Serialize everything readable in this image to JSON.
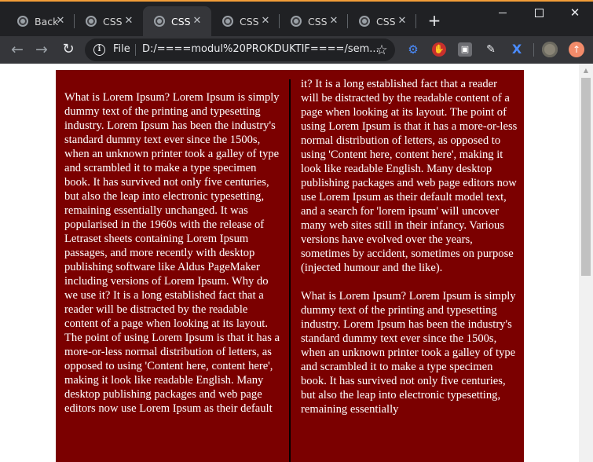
{
  "tabs": [
    {
      "label": "Back",
      "active": false
    },
    {
      "label": "CSS",
      "active": false
    },
    {
      "label": "CSS",
      "active": true
    },
    {
      "label": "CSS",
      "active": false
    },
    {
      "label": "CSS",
      "active": false
    },
    {
      "label": "CSS",
      "active": false
    }
  ],
  "toolbar": {
    "scheme": "File",
    "url": "D:/====modul%20PROKDUKTIF====/sem..."
  },
  "article": {
    "left_paragraphs": [
      "What is Lorem Ipsum? Lorem Ipsum is simply dummy text of the printing and typesetting industry. Lorem Ipsum has been the industry's standard dummy text ever since the 1500s, when an unknown printer took a galley of type and scrambled it to make a type specimen book. It has survived not only five centuries, but also the leap into electronic typesetting, remaining essentially unchanged. It was popularised in the 1960s with the release of Letraset sheets containing Lorem Ipsum passages, and more recently with desktop publishing software like Aldus PageMaker including versions of Lorem Ipsum. Why do we use it? It is a long established fact that a reader will be distracted by the readable content of a page when looking at its layout. The point of using Lorem Ipsum is that it has a more-or-less normal distribution of letters, as opposed to using 'Content here, content here', making it look like readable English. Many desktop publishing packages and web page editors now use Lorem Ipsum as their default"
    ],
    "right_paragraphs": [
      "it? It is a long established fact that a reader will be distracted by the readable content of a page when looking at its layout. The point of using Lorem Ipsum is that it has a more-or-less normal distribution of letters, as opposed to using 'Content here, content here', making it look like readable English. Many desktop publishing packages and web page editors now use Lorem Ipsum as their default model text, and a search for 'lorem ipsum' will uncover many web sites still in their infancy. Various versions have evolved over the years, sometimes by accident, sometimes on purpose (injected humour and the like).",
      "What is Lorem Ipsum? Lorem Ipsum is simply dummy text of the printing and typesetting industry. Lorem Ipsum has been the industry's standard dummy text ever since the 1500s, when an unknown printer took a galley of type and scrambled it to make a type specimen book. It has survived not only five centuries, but also the leap into electronic typesetting, remaining essentially"
    ]
  },
  "colors": {
    "article_background": "#7b0000",
    "column_rule": "#000000",
    "tab_strip": "#202124",
    "toolbar": "#35363a"
  }
}
